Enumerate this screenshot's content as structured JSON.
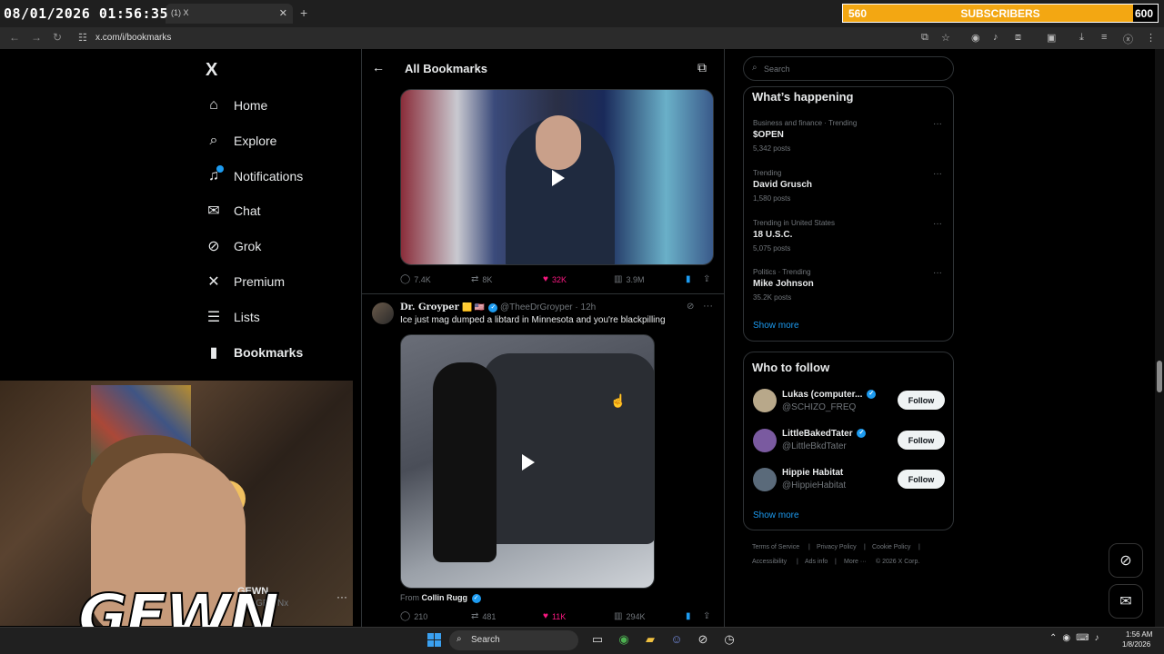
{
  "overlay": {
    "timestamp": "08/01/2026 01:56:35",
    "subscribers_start": "560",
    "subscribers_label": "SUBSCRIBERS",
    "subscribers_goal": "600",
    "subscribers_progress": 0,
    "watermark": "GEWN"
  },
  "browser": {
    "tab_title": "(1) X",
    "url": "x.com/i/bookmarks"
  },
  "nav": {
    "logo": "X",
    "items": [
      {
        "label": "Home",
        "icon": "home-icon"
      },
      {
        "label": "Explore",
        "icon": "search-icon"
      },
      {
        "label": "Notifications",
        "icon": "bell-icon"
      },
      {
        "label": "Chat",
        "icon": "mail-icon"
      },
      {
        "label": "Grok",
        "icon": "grok-icon"
      },
      {
        "label": "Premium",
        "icon": "x-icon"
      },
      {
        "label": "Lists",
        "icon": "list-icon"
      },
      {
        "label": "Bookmarks",
        "icon": "bookmark-icon"
      }
    ],
    "notification_badge": "1",
    "account": {
      "name": "GEWN",
      "handle": "@GEWNx"
    }
  },
  "main": {
    "title": "All Bookmarks",
    "tweet1": {
      "replies": "7.4K",
      "retweets": "8K",
      "likes": "32K",
      "views": "3.9M"
    },
    "tweet2": {
      "name": "Dr. Groyper",
      "badges": "🟨 🇺🇸",
      "handle": "@TheeDrGroyper · 12h",
      "text": "Ice just mag dumped a libtard in Minnesota and you're blackpilling",
      "from_prefix": "From",
      "from_name": "Collin Rugg",
      "replies": "210",
      "retweets": "481",
      "likes": "11K",
      "views": "294K"
    }
  },
  "right": {
    "search_placeholder": "Search",
    "trends_title": "What’s happening",
    "trends": [
      {
        "context": "Business and finance · Trending",
        "name": "$OPEN",
        "count": "5,342 posts"
      },
      {
        "context": "Trending",
        "name": "David Grusch",
        "count": "1,580 posts"
      },
      {
        "context": "Trending in United States",
        "name": "18 U.S.C.",
        "count": "5,075 posts"
      },
      {
        "context": "Politics · Trending",
        "name": "Mike Johnson",
        "count": "35.2K posts"
      }
    ],
    "show_more": "Show more",
    "wtf_title": "Who to follow",
    "who_to_follow": [
      {
        "name": "Lukas (computer...",
        "handle": "@SCHIZO_FREQ",
        "button": "Follow",
        "color": "#b8a88a"
      },
      {
        "name": "LittleBakedTater",
        "handle": "@LittleBkdTater",
        "button": "Follow",
        "color": "#7a5aa0"
      },
      {
        "name": "Hippie Habitat",
        "handle": "@HippieHabitat",
        "button": "Follow",
        "color": "#5a6a7a"
      }
    ],
    "footer": {
      "links_row1": [
        "Terms of Service",
        "|",
        "Privacy Policy",
        "|",
        "Cookie Policy",
        "|"
      ],
      "links_row2": [
        "Accessibility",
        "|",
        "Ads info",
        "|",
        "More ···",
        "© 2026 X Corp."
      ]
    }
  },
  "taskbar": {
    "search_label": "Search",
    "time": "1:56 AM",
    "date": "1/8/2026"
  },
  "colors": {
    "accent": "#1d9bf0",
    "like": "#f91880",
    "subscriber_bar": "#f3a712"
  }
}
